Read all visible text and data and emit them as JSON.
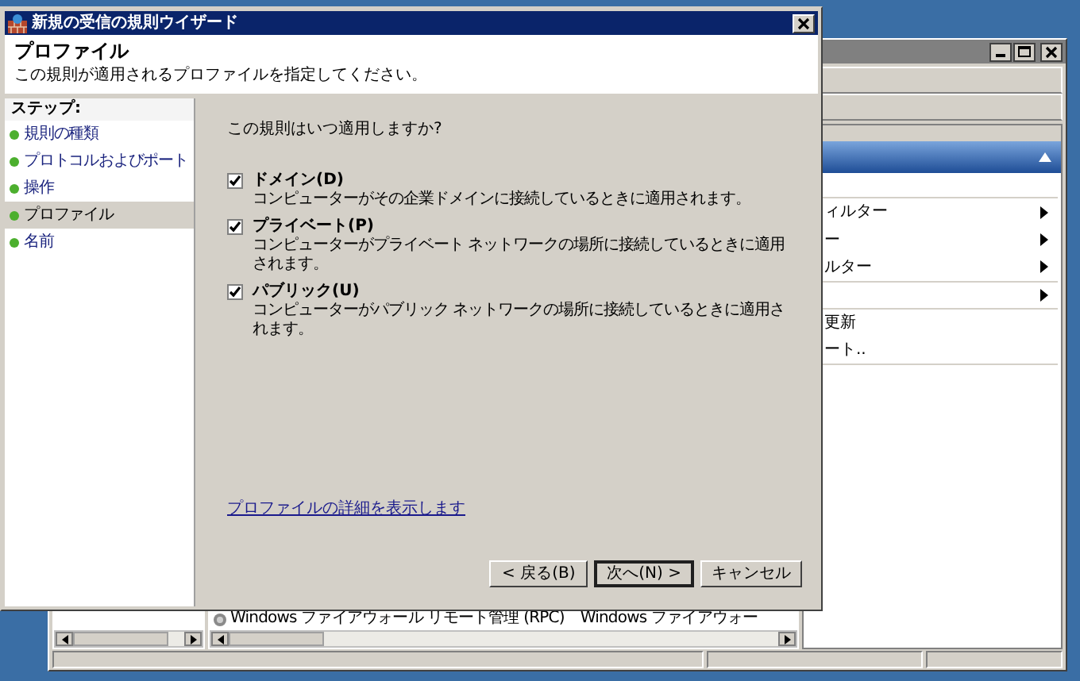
{
  "background_window": {
    "action_pane": {
      "items": [
        {
          "label": "ィルター",
          "submenu": true
        },
        {
          "label": "ー",
          "submenu": true
        },
        {
          "label": "ルター",
          "submenu": true
        },
        {
          "submenu": true
        },
        {
          "label": "更新",
          "submenu": false
        },
        {
          "label": "ート..",
          "submenu": false
        }
      ]
    },
    "list_row": {
      "name": "Windows ファイアウォール リモート管理 (RPC)",
      "column_2": "Windows ファイアウォー"
    }
  },
  "dialog": {
    "title": "新規の受信の規則ウイザード",
    "header": {
      "title": "プロファイル",
      "subtitle": "この規則が適用されるプロファイルを指定してください。"
    },
    "steps": {
      "heading": "ステップ:",
      "items": [
        {
          "label": "規則の種類",
          "selected": false
        },
        {
          "label": "プロトコルおよびポート",
          "selected": false
        },
        {
          "label": "操作",
          "selected": false
        },
        {
          "label": "プロファイル",
          "selected": true
        },
        {
          "label": "名前",
          "selected": false
        }
      ]
    },
    "question": "この規則はいつ適用しますか?",
    "options": [
      {
        "label": "ドメイン(D)",
        "description": "コンピューターがその企業ドメインに接続しているときに適用されます。",
        "checked": true
      },
      {
        "label": "プライベート(P)",
        "description": "コンピューターがプライベート ネットワークの場所に接続しているときに適用されます。",
        "checked": true
      },
      {
        "label": "パブリック(U)",
        "description": "コンピューターがパブリック ネットワークの場所に接続しているときに適用されます。",
        "checked": true
      }
    ],
    "link": "プロファイルの詳細を表示します",
    "buttons": [
      {
        "label": "< 戻る(B)",
        "default": false
      },
      {
        "label": "次へ(N) >",
        "default": true
      },
      {
        "label": "キャンセル",
        "default": false
      }
    ]
  }
}
